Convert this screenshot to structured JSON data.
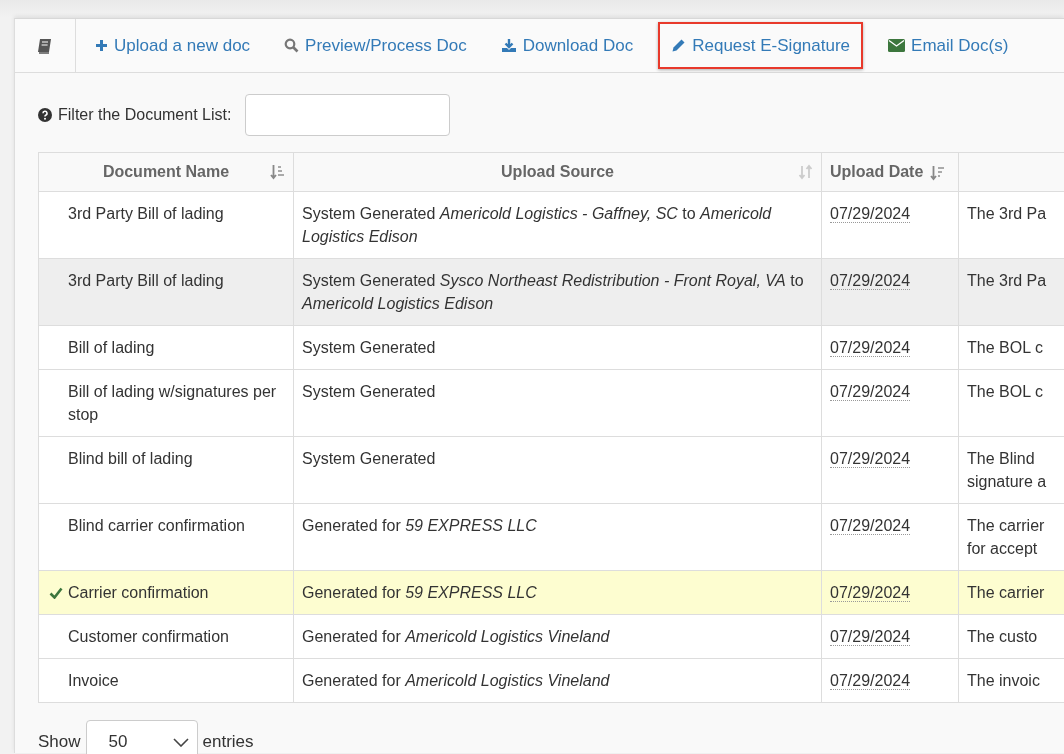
{
  "toolbar": {
    "items": [
      {
        "kind": "plus",
        "label": "Upload a new doc",
        "highlighted": false
      },
      {
        "kind": "search",
        "label": "Preview/Process Doc",
        "highlighted": false
      },
      {
        "kind": "download",
        "label": "Download Doc",
        "highlighted": false
      },
      {
        "kind": "pencil",
        "label": "Request E-Signature",
        "highlighted": true
      },
      {
        "kind": "envelope",
        "label": "Email Doc(s)",
        "highlighted": false
      }
    ]
  },
  "filter": {
    "label": "Filter the Document List:"
  },
  "table": {
    "columns": [
      {
        "label": "Document Name",
        "kind": "ascending"
      },
      {
        "label": "Upload Source",
        "kind": "unsorted"
      },
      {
        "label": "Upload Date",
        "kind": "descending"
      },
      {}
    ],
    "rows": [
      {
        "name": "3rd Party Bill of lading",
        "source": "System Generated *Americold Logistics - Gaffney, SC* to *Americold Logistics Edison*",
        "date": "07/29/2024",
        "column_4": [
          "The 3rd Pa"
        ],
        "selected": false,
        "hovered": false
      },
      {
        "name": "3rd Party Bill of lading",
        "source": "System Generated *Sysco Northeast Redistribution - Front Royal, VA* to *Americold Logistics Edison*",
        "date": "07/29/2024",
        "column_4": [
          "The 3rd Pa"
        ],
        "selected": false,
        "hovered": true
      },
      {
        "name": "Bill of lading",
        "source": "System Generated",
        "date": "07/29/2024",
        "column_4": [
          "The BOL c"
        ],
        "selected": false,
        "hovered": false
      },
      {
        "name": "Bill of lading w/signatures per stop",
        "source": "System Generated",
        "date": "07/29/2024",
        "column_4": [
          "The BOL c"
        ],
        "selected": false,
        "hovered": false
      },
      {
        "name": "Blind bill of lading",
        "source": "System Generated",
        "date": "07/29/2024",
        "column_4": [
          "The Blind",
          "signature a"
        ],
        "selected": false,
        "hovered": false
      },
      {
        "name": "Blind carrier confirmation",
        "source": "Generated for *59 EXPRESS LLC*",
        "date": "07/29/2024",
        "column_4": [
          "The carrier",
          "for accept"
        ],
        "selected": false,
        "hovered": false
      },
      {
        "name": "Carrier confirmation",
        "source": "Generated for *59 EXPRESS LLC*",
        "date": "07/29/2024",
        "column_4": [
          "The carrier"
        ],
        "selected": true,
        "hovered": false
      },
      {
        "name": "Customer confirmation",
        "source": "Generated for *Americold Logistics Vineland*",
        "date": "07/29/2024",
        "column_4": [
          "The custo"
        ],
        "selected": false,
        "hovered": false
      },
      {
        "name": "Invoice",
        "source": "Generated for *Americold Logistics Vineland*",
        "date": "07/29/2024",
        "column_4": [
          "The invoic"
        ],
        "selected": false,
        "hovered": false
      }
    ]
  },
  "length": {
    "before": "Show",
    "value": "50",
    "after": "entries"
  }
}
